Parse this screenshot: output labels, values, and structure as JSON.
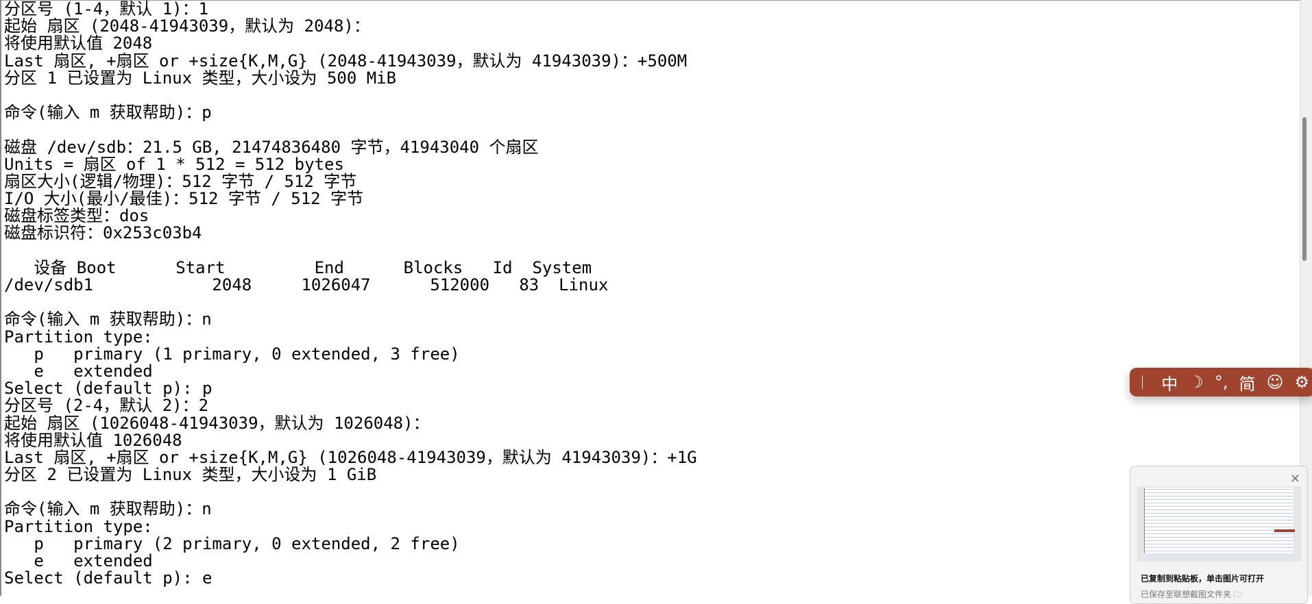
{
  "terminal": {
    "lines": [
      "分区号 (1-4，默认 1)：1",
      "起始 扇区 (2048-41943039，默认为 2048)：",
      "将使用默认值 2048",
      "Last 扇区, +扇区 or +size{K,M,G} (2048-41943039，默认为 41943039)：+500M",
      "分区 1 已设置为 Linux 类型，大小设为 500 MiB",
      "",
      "命令(输入 m 获取帮助)：p",
      "",
      "磁盘 /dev/sdb：21.5 GB, 21474836480 字节，41943040 个扇区",
      "Units = 扇区 of 1 * 512 = 512 bytes",
      "扇区大小(逻辑/物理)：512 字节 / 512 字节",
      "I/O 大小(最小/最佳)：512 字节 / 512 字节",
      "磁盘标签类型：dos",
      "磁盘标识符：0x253c03b4",
      "",
      "   设备 Boot      Start         End      Blocks   Id  System",
      "/dev/sdb1            2048     1026047      512000   83  Linux",
      "",
      "命令(输入 m 获取帮助)：n",
      "Partition type:",
      "   p   primary (1 primary, 0 extended, 3 free)",
      "   e   extended",
      "Select (default p): p",
      "分区号 (2-4，默认 2)：2",
      "起始 扇区 (1026048-41943039，默认为 1026048)：",
      "将使用默认值 1026048",
      "Last 扇区, +扇区 or +size{K,M,G} (1026048-41943039，默认为 41943039)：+1G",
      "分区 2 已设置为 Linux 类型，大小设为 1 GiB",
      "",
      "命令(输入 m 获取帮助)：n",
      "Partition type:",
      "   p   primary (2 primary, 0 extended, 2 free)",
      "   e   extended",
      "Select (default p): e"
    ]
  },
  "ime_toolbar": {
    "color": "#a0432f",
    "mode": "中",
    "moon_icon": "☽",
    "punct": "°,",
    "charset": "简",
    "emoji_icon": "☺",
    "settings_icon": "⚙"
  },
  "notification": {
    "title": "已复制到粘贴板，单击图片可打开",
    "subtitle": "已保存至联想截图文件夹",
    "close": "✕",
    "folder_icon": "🗀"
  }
}
